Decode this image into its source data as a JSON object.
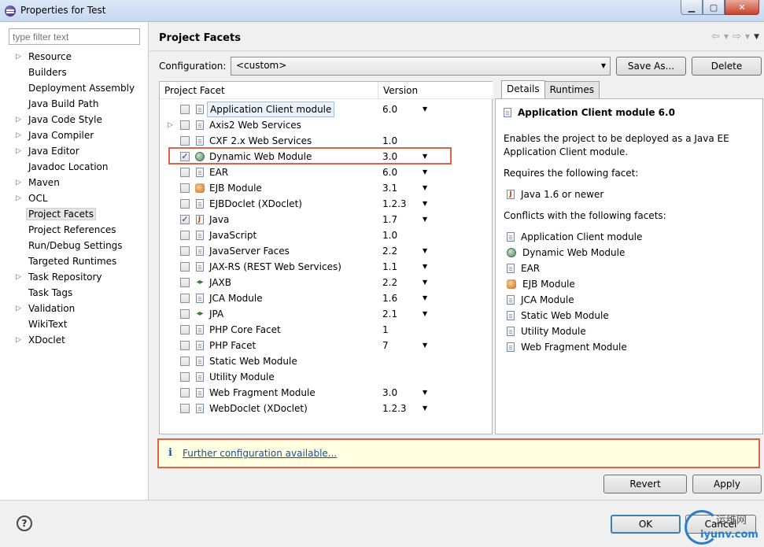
{
  "window": {
    "title": "Properties for Test"
  },
  "filter": {
    "placeholder": "type filter text"
  },
  "tree": [
    {
      "label": "Resource",
      "expandable": true
    },
    {
      "label": "Builders",
      "expandable": false
    },
    {
      "label": "Deployment Assembly",
      "expandable": false
    },
    {
      "label": "Java Build Path",
      "expandable": false
    },
    {
      "label": "Java Code Style",
      "expandable": true
    },
    {
      "label": "Java Compiler",
      "expandable": true
    },
    {
      "label": "Java Editor",
      "expandable": true
    },
    {
      "label": "Javadoc Location",
      "expandable": false
    },
    {
      "label": "Maven",
      "expandable": true
    },
    {
      "label": "OCL",
      "expandable": true
    },
    {
      "label": "Project Facets",
      "expandable": false,
      "selected": true
    },
    {
      "label": "Project References",
      "expandable": false
    },
    {
      "label": "Run/Debug Settings",
      "expandable": false
    },
    {
      "label": "Targeted Runtimes",
      "expandable": false
    },
    {
      "label": "Task Repository",
      "expandable": true
    },
    {
      "label": "Task Tags",
      "expandable": false
    },
    {
      "label": "Validation",
      "expandable": true
    },
    {
      "label": "WikiText",
      "expandable": false
    },
    {
      "label": "XDoclet",
      "expandable": true
    }
  ],
  "page": {
    "title": "Project Facets"
  },
  "configuration": {
    "label": "Configuration:",
    "value": "<custom>",
    "save_as": "Save As...",
    "delete": "Delete"
  },
  "facets_table": {
    "col_facet": "Project Facet",
    "col_version": "Version",
    "rows": [
      {
        "name": "Application Client module",
        "version": "6.0",
        "checked": false,
        "dropdown": true,
        "icon": "doc"
      },
      {
        "name": "Axis2 Web Services",
        "version": "",
        "checked": false,
        "dropdown": false,
        "icon": "doc",
        "expandable": true
      },
      {
        "name": "CXF 2.x Web Services",
        "version": "1.0",
        "checked": false,
        "dropdown": false,
        "icon": "doc"
      },
      {
        "name": "Dynamic Web Module",
        "version": "3.0",
        "checked": true,
        "dropdown": true,
        "icon": "globe"
      },
      {
        "name": "EAR",
        "version": "6.0",
        "checked": false,
        "dropdown": true,
        "icon": "doc"
      },
      {
        "name": "EJB Module",
        "version": "3.1",
        "checked": false,
        "dropdown": true,
        "icon": "bean"
      },
      {
        "name": "EJBDoclet (XDoclet)",
        "version": "1.2.3",
        "checked": false,
        "dropdown": true,
        "icon": "doc"
      },
      {
        "name": "Java",
        "version": "1.7",
        "checked": true,
        "dropdown": true,
        "icon": "java"
      },
      {
        "name": "JavaScript",
        "version": "1.0",
        "checked": false,
        "dropdown": false,
        "icon": "doc"
      },
      {
        "name": "JavaServer Faces",
        "version": "2.2",
        "checked": false,
        "dropdown": true,
        "icon": "doc"
      },
      {
        "name": "JAX-RS (REST Web Services)",
        "version": "1.1",
        "checked": false,
        "dropdown": true,
        "icon": "doc"
      },
      {
        "name": "JAXB",
        "version": "2.2",
        "checked": false,
        "dropdown": true,
        "icon": "arrows"
      },
      {
        "name": "JCA Module",
        "version": "1.6",
        "checked": false,
        "dropdown": true,
        "icon": "doc"
      },
      {
        "name": "JPA",
        "version": "2.1",
        "checked": false,
        "dropdown": true,
        "icon": "arrows"
      },
      {
        "name": "PHP Core Facet",
        "version": "1",
        "checked": false,
        "dropdown": false,
        "icon": "doc"
      },
      {
        "name": "PHP Facet",
        "version": "7",
        "checked": false,
        "dropdown": true,
        "icon": "doc"
      },
      {
        "name": "Static Web Module",
        "version": "",
        "checked": false,
        "dropdown": false,
        "icon": "doc"
      },
      {
        "name": "Utility Module",
        "version": "",
        "checked": false,
        "dropdown": false,
        "icon": "doc"
      },
      {
        "name": "Web Fragment Module",
        "version": "3.0",
        "checked": false,
        "dropdown": true,
        "icon": "doc"
      },
      {
        "name": "WebDoclet (XDoclet)",
        "version": "1.2.3",
        "checked": false,
        "dropdown": true,
        "icon": "doc"
      }
    ]
  },
  "details": {
    "tab_details": "Details",
    "tab_runtimes": "Runtimes",
    "title": "Application Client module 6.0",
    "description": "Enables the project to be deployed as a Java EE Application Client module.",
    "requires_label": "Requires the following facet:",
    "requires": [
      {
        "name": "Java 1.6 or newer",
        "icon": "java"
      }
    ],
    "conflicts_label": "Conflicts with the following facets:",
    "conflicts": [
      {
        "name": "Application Client module",
        "icon": "doc"
      },
      {
        "name": "Dynamic Web Module",
        "icon": "globe"
      },
      {
        "name": "EAR",
        "icon": "doc"
      },
      {
        "name": "EJB Module",
        "icon": "bean"
      },
      {
        "name": "JCA Module",
        "icon": "doc"
      },
      {
        "name": "Static Web Module",
        "icon": "doc"
      },
      {
        "name": "Utility Module",
        "icon": "doc"
      },
      {
        "name": "Web Fragment Module",
        "icon": "doc"
      }
    ]
  },
  "infobar": {
    "icon": "i",
    "link": "Further configuration available..."
  },
  "buttons": {
    "revert": "Revert",
    "apply": "Apply",
    "ok": "OK",
    "cancel": "Cancel",
    "help": "?"
  },
  "watermark": {
    "text1": "运维网",
    "text2": "iyunv.com"
  }
}
